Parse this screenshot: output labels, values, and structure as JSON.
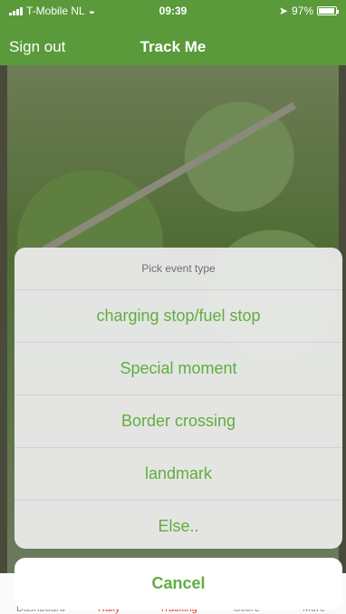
{
  "status": {
    "carrier": "T-Mobile NL",
    "time": "09:39",
    "battery": "97%",
    "battery_level": 0.97
  },
  "nav": {
    "sign_out": "Sign out",
    "title": "Track Me"
  },
  "sheet": {
    "title": "Pick event type",
    "items": [
      {
        "label": "charging stop/fuel stop"
      },
      {
        "label": "Special moment"
      },
      {
        "label": "Border crossing"
      },
      {
        "label": "landmark"
      },
      {
        "label": "Else.."
      }
    ]
  },
  "cancel": {
    "label": "Cancel"
  },
  "tabs": [
    {
      "label": "Dashboard"
    },
    {
      "label": "Rally"
    },
    {
      "label": "Tracking"
    },
    {
      "label": "Score"
    },
    {
      "label": "More"
    }
  ],
  "colors": {
    "header": "#5a9a3a",
    "accent": "#61ad3f",
    "active_tab": "#e03a2f"
  }
}
